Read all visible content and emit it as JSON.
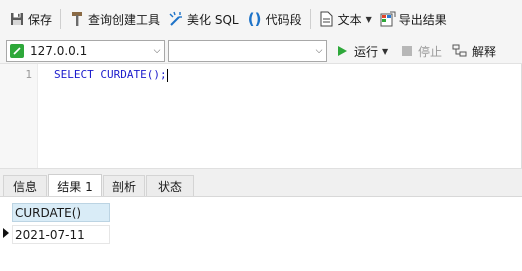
{
  "toolbar": {
    "save_label": "保存",
    "query_builder_label": "查询创建工具",
    "beautify_label": "美化 SQL",
    "snippet_label": "代码段",
    "text_label": "文本",
    "export_label": "导出结果"
  },
  "connection": {
    "host": "127.0.0.1",
    "database": ""
  },
  "run_controls": {
    "run_label": "运行",
    "stop_label": "停止",
    "explain_label": "解释"
  },
  "editor": {
    "line_number": "1",
    "sql": "SELECT CURDATE();"
  },
  "tabs": [
    {
      "label": "信息"
    },
    {
      "label": "结果 1"
    },
    {
      "label": "剖析"
    },
    {
      "label": "状态"
    }
  ],
  "results": {
    "columns": [
      "CURDATE()"
    ],
    "rows": [
      [
        "2021-07-11"
      ]
    ]
  },
  "colors": {
    "run_icon": "#2ea83a",
    "sql_keyword": "#1c1ccc",
    "header_bg": "#d9ecf7"
  }
}
